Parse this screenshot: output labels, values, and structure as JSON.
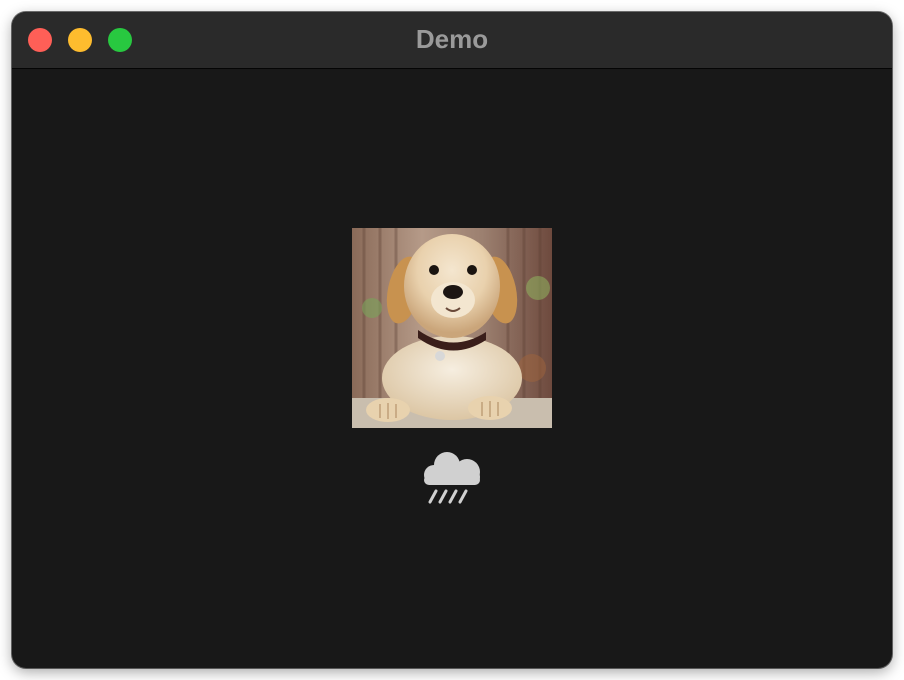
{
  "window": {
    "title": "Demo",
    "controls": {
      "close_color": "#ff5f57",
      "minimize_color": "#febc2e",
      "maximize_color": "#28c840"
    },
    "background": "#181818",
    "titlebar_background": "#2a2a2a"
  },
  "content": {
    "image": {
      "icon": "puppy-photo"
    },
    "weather_icon": {
      "icon": "cloud-rain-icon",
      "color": "#d0d0d0"
    }
  }
}
